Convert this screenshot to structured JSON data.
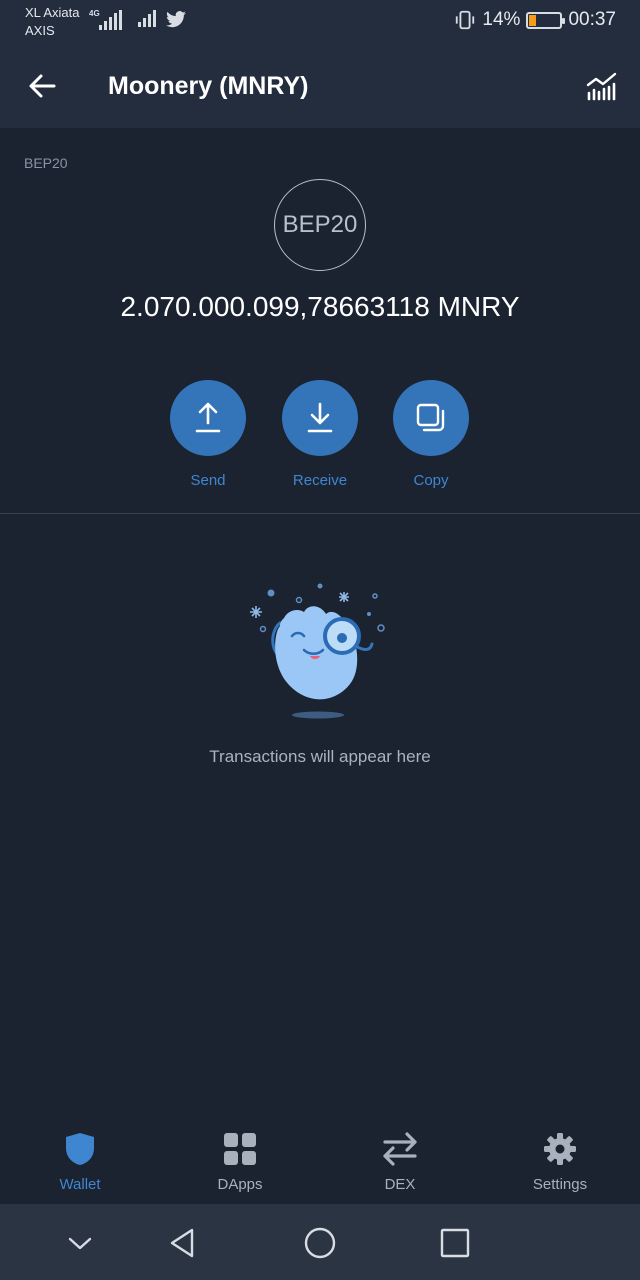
{
  "status_bar": {
    "carrier_primary": "XL Axiata",
    "carrier_secondary": "AXIS",
    "network_type": "4G",
    "battery_percent": "14%",
    "time": "00:37",
    "battery_color": "#f59c1a"
  },
  "header": {
    "title": "Moonery (MNRY)",
    "back_icon": "arrow-left-icon",
    "chart_icon": "market-chart-icon"
  },
  "token": {
    "network_label": "BEP20",
    "logo_text": "BEP20",
    "balance": "2.070.000.099,78663118 MNRY"
  },
  "actions": [
    {
      "label": "Send",
      "icon": "upload-arrow-icon"
    },
    {
      "label": "Receive",
      "icon": "download-arrow-icon"
    },
    {
      "label": "Copy",
      "icon": "copy-icon"
    }
  ],
  "empty_state": {
    "message": "Transactions will appear here",
    "illustration": "magnifying-mascot-icon"
  },
  "tab_bar": {
    "items": [
      {
        "label": "Wallet",
        "icon": "shield-icon",
        "active": true
      },
      {
        "label": "DApps",
        "icon": "grid-icon",
        "active": false
      },
      {
        "label": "DEX",
        "icon": "swap-arrows-icon",
        "active": false
      },
      {
        "label": "Settings",
        "icon": "gear-icon",
        "active": false
      }
    ]
  },
  "colors": {
    "background": "#1b2230",
    "header": "#232d3d",
    "accent": "#3474b8",
    "accent_text": "#3f86d1"
  }
}
